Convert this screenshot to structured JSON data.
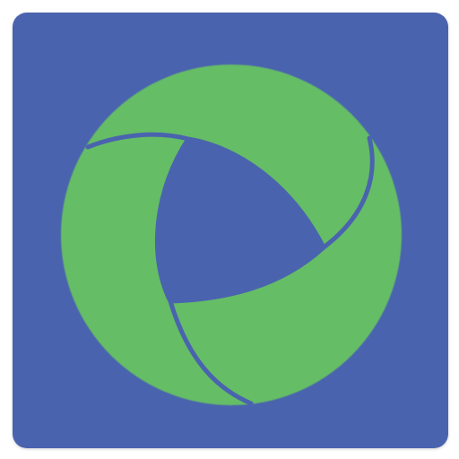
{
  "icon": {
    "name": "swirl-logo-icon",
    "description_colors": {
      "background": "#4a63ae",
      "logo": "#65bd66"
    }
  }
}
